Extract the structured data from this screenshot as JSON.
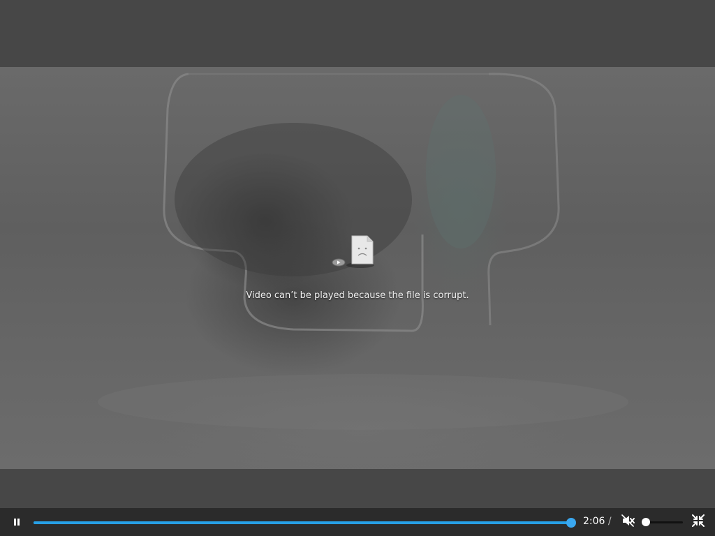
{
  "player": {
    "error_message": "Video can’t be played because the file is corrupt.",
    "time_current": "2:06",
    "time_separator": "/",
    "progress_fraction": 1.0,
    "volume_fraction": 0.0,
    "muted": true,
    "playing": true
  },
  "icons": {
    "play_pause": "pause-icon",
    "mute": "mute-icon",
    "fullscreen": "exit-fullscreen-icon",
    "error": "broken-file-icon"
  },
  "colors": {
    "progress": "#27a0e6",
    "controls_bg": "#2b2b2b",
    "volume_thumb": "#ffffff"
  }
}
